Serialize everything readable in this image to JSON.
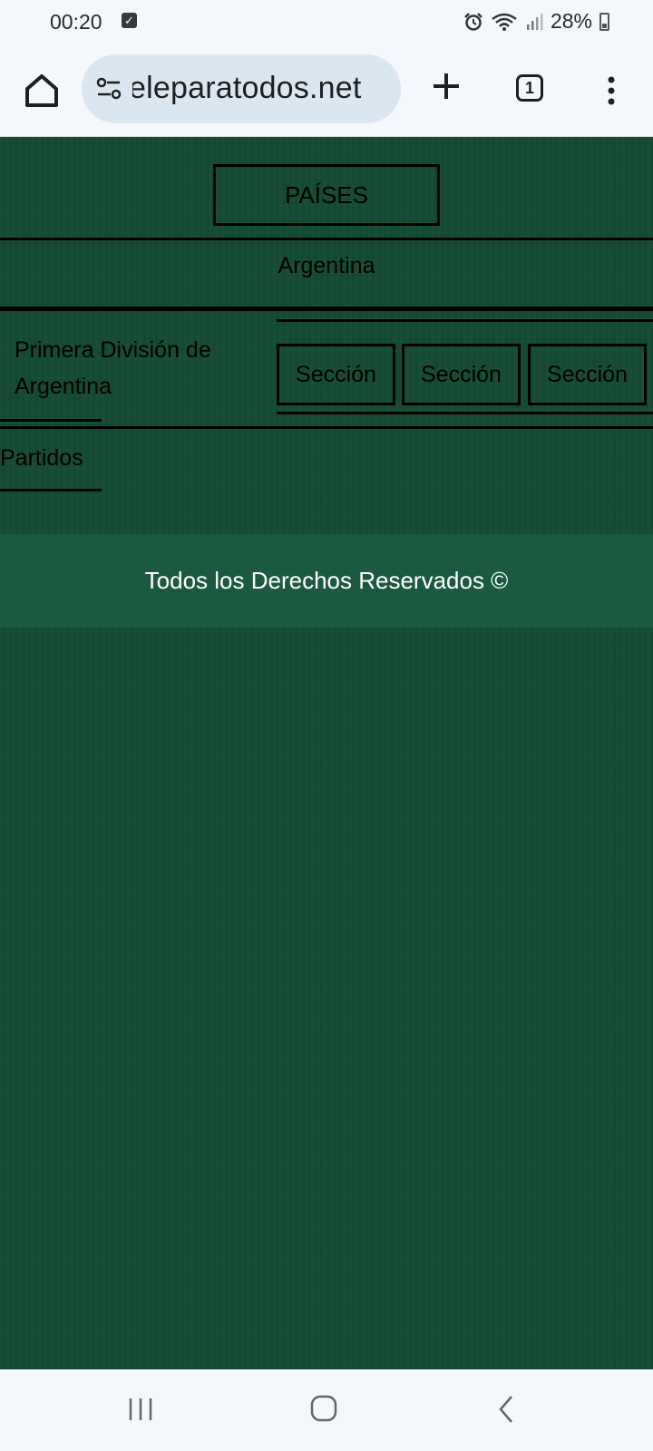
{
  "status_bar": {
    "time": "00:20",
    "battery": "28%",
    "icons": [
      "check-icon",
      "alarm-icon",
      "wifi-icon",
      "signal-icon",
      "battery-icon"
    ]
  },
  "browser": {
    "url": "eleparatodos.net",
    "tab_count": "1",
    "icons": [
      "home-icon",
      "site-settings-icon",
      "new-tab-icon",
      "tabs-icon",
      "more-menu-icon"
    ]
  },
  "page": {
    "countries_button": "PAÍSES",
    "country": "Argentina",
    "league": "Primera División de Argentina",
    "sections": [
      "Sección",
      "Sección",
      "Sección"
    ],
    "matches_label": "Partidos",
    "footer": "Todos los Derechos Reservados ©",
    "colors": {
      "background": "#154b33",
      "footer": "#1b5a3f",
      "text": "#000000",
      "footer_text": "#ffffff"
    }
  },
  "nav_bar": {
    "icons": [
      "recents-icon",
      "home-nav-icon",
      "back-icon"
    ]
  }
}
